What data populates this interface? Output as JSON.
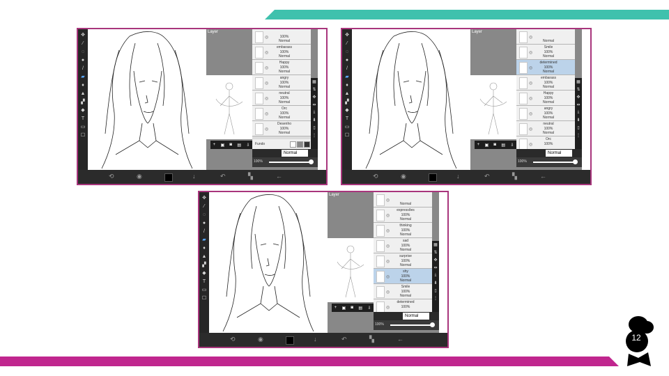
{
  "page_number": "12",
  "layer_panel_title": "Layer",
  "blend_mode": "Normal",
  "opacity_readout": "100%",
  "colors": {
    "teal": "#3fc1ad",
    "magenta": "#c0268e",
    "frame": "#a8357c"
  },
  "screenshots": [
    {
      "layers": [
        {
          "name": "",
          "opacity": "100%",
          "mode": "Normal",
          "selected": false
        },
        {
          "name": "embarass",
          "opacity": "100%",
          "mode": "Normal",
          "selected": false
        },
        {
          "name": "Happy",
          "opacity": "100%",
          "mode": "Normal",
          "selected": false
        },
        {
          "name": "angry",
          "opacity": "100%",
          "mode": "Normal",
          "selected": false
        },
        {
          "name": "neutral",
          "opacity": "100%",
          "mode": "Normal",
          "selected": false
        },
        {
          "name": "Orc",
          "opacity": "100%",
          "mode": "Normal",
          "selected": false
        },
        {
          "name": "Desenho",
          "opacity": "100%",
          "mode": "Normal",
          "selected": false
        }
      ],
      "background_layer": "Fundo"
    },
    {
      "layers": [
        {
          "name": "",
          "opacity": "",
          "mode": "Normal",
          "selected": false
        },
        {
          "name": "Smile",
          "opacity": "100%",
          "mode": "Normal",
          "selected": false
        },
        {
          "name": "determined",
          "opacity": "100%",
          "mode": "Normal",
          "selected": true
        },
        {
          "name": "embarass",
          "opacity": "100%",
          "mode": "Normal",
          "selected": false
        },
        {
          "name": "Happy",
          "opacity": "100%",
          "mode": "Normal",
          "selected": false
        },
        {
          "name": "angry",
          "opacity": "100%",
          "mode": "Normal",
          "selected": false
        },
        {
          "name": "neutral",
          "opacity": "100%",
          "mode": "Normal",
          "selected": false
        },
        {
          "name": "Orc",
          "opacity": "100%",
          "mode": "",
          "selected": false
        }
      ],
      "background_layer": ""
    },
    {
      "layers": [
        {
          "name": "",
          "opacity": "",
          "mode": "Normal",
          "selected": false
        },
        {
          "name": "expressões",
          "opacity": "100%",
          "mode": "Normal",
          "selected": false
        },
        {
          "name": "thinking",
          "opacity": "100%",
          "mode": "Normal",
          "selected": false
        },
        {
          "name": "sad",
          "opacity": "100%",
          "mode": "Normal",
          "selected": false
        },
        {
          "name": "surprise",
          "opacity": "100%",
          "mode": "Normal",
          "selected": false
        },
        {
          "name": "shy",
          "opacity": "100%",
          "mode": "Normal",
          "selected": true
        },
        {
          "name": "Smile",
          "opacity": "100%",
          "mode": "Normal",
          "selected": false
        },
        {
          "name": "determined",
          "opacity": "100%",
          "mode": "",
          "selected": false
        }
      ],
      "background_layer": ""
    }
  ]
}
